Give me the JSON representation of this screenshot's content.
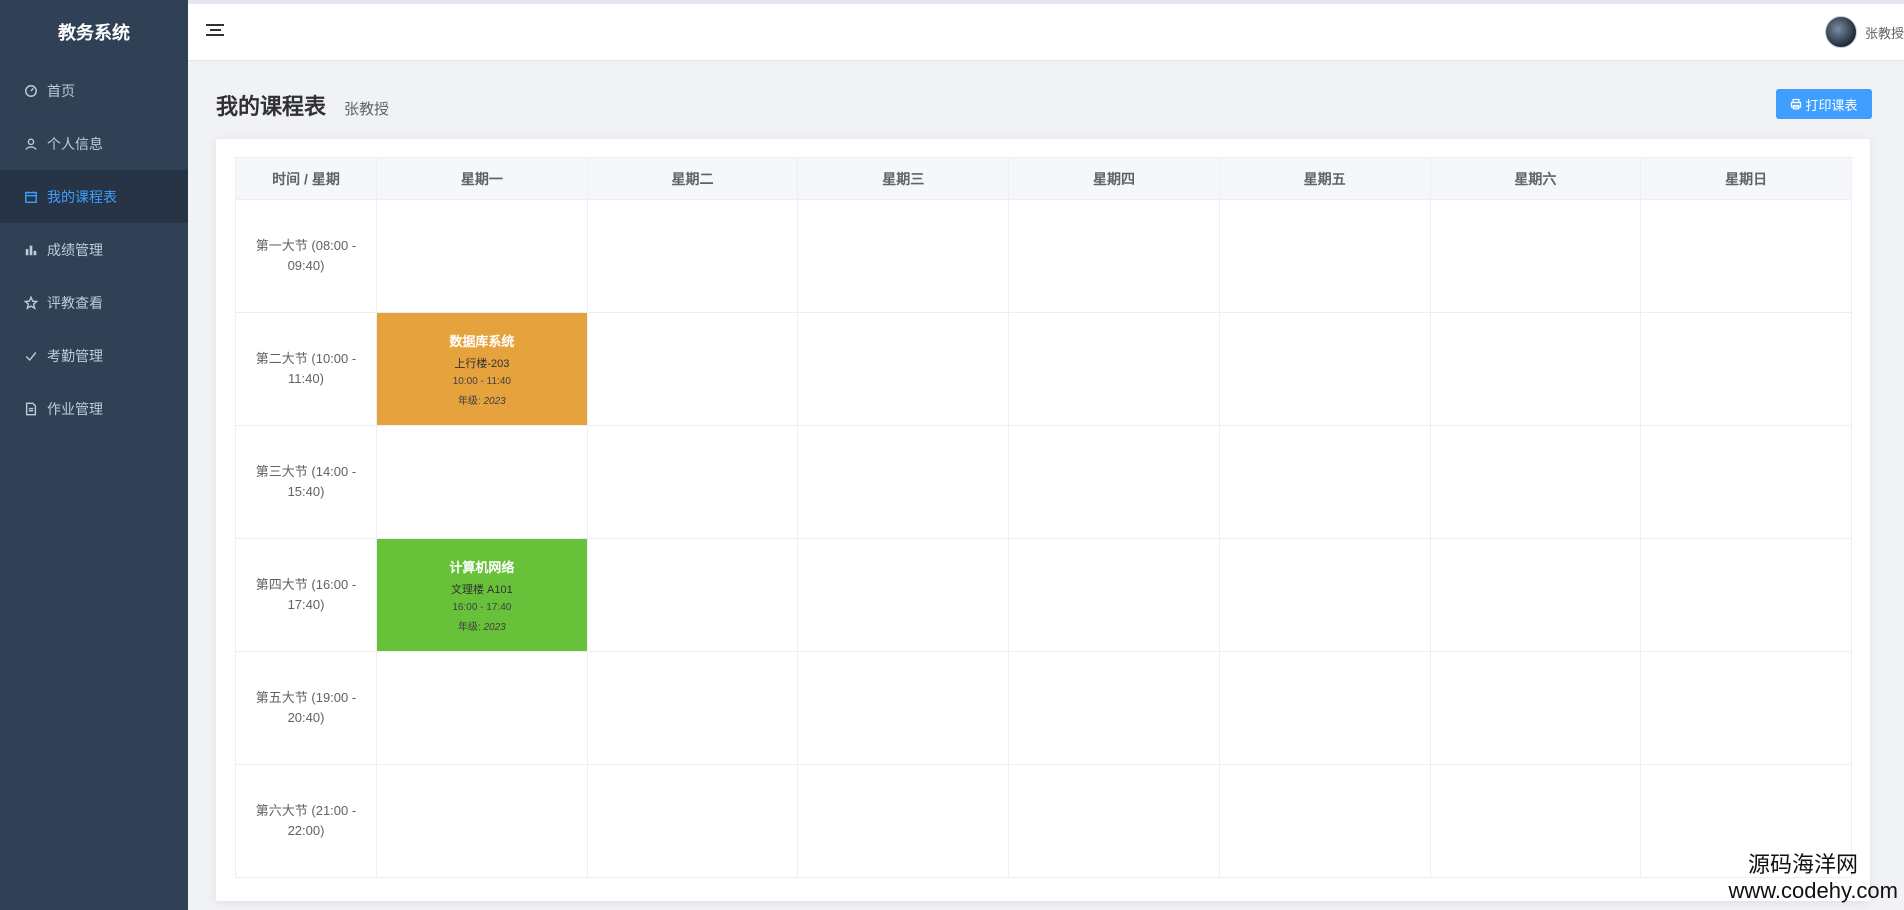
{
  "sidebar": {
    "brand": "教务系统",
    "items": [
      {
        "label": "首页",
        "icon": "dashboard-icon"
      },
      {
        "label": "个人信息",
        "icon": "user-icon"
      },
      {
        "label": "我的课程表",
        "icon": "calendar-icon",
        "active": true
      },
      {
        "label": "成绩管理",
        "icon": "bar-chart-icon"
      },
      {
        "label": "评教查看",
        "icon": "star-icon"
      },
      {
        "label": "考勤管理",
        "icon": "check-icon"
      },
      {
        "label": "作业管理",
        "icon": "document-icon"
      }
    ]
  },
  "header": {
    "user_name": "张教授"
  },
  "main": {
    "title": "我的课程表",
    "subtitle": "张教授",
    "print_button": "打印课表"
  },
  "schedule": {
    "corner": "时间 / 星期",
    "days": [
      "星期一",
      "星期二",
      "星期三",
      "星期四",
      "星期五",
      "星期六",
      "星期日"
    ],
    "periods": [
      "第一大节 (08:00 - 09:40)",
      "第二大节 (10:00 - 11:40)",
      "第三大节 (14:00 - 15:40)",
      "第四大节 (16:00 - 17:40)",
      "第五大节 (19:00 - 20:40)",
      "第六大节 (21:00 - 22:00)"
    ],
    "courses": {
      "p2_mon": {
        "name": "数据库系统",
        "room": "上行楼-203",
        "time": "10:00 - 11:40",
        "grade_label": "年级: ",
        "grade": "2023",
        "color": "#e6a23c"
      },
      "p4_mon": {
        "name": "计算机网络",
        "room": "文理楼 A101",
        "time": "16:00 - 17:40",
        "grade_label": "年级: ",
        "grade": "2023",
        "color": "#67c23a"
      }
    }
  },
  "watermark": {
    "line1": "源码海洋网",
    "line2": "www.codehy.com"
  },
  "colors": {
    "sidebar_bg": "#304156",
    "accent": "#409eff"
  }
}
